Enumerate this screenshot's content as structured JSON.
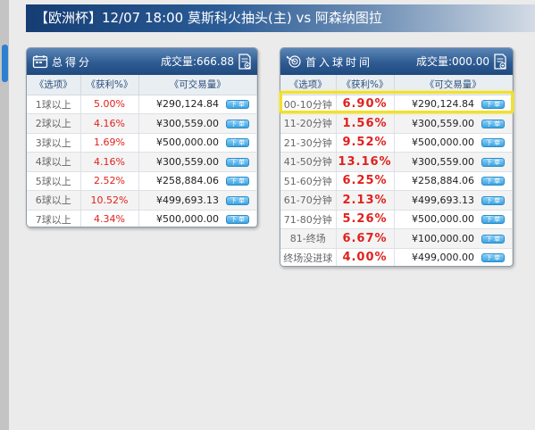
{
  "title": "【欧洲杯】12/07 18:00 莫斯科火抽头(主) vs 阿森纳图拉",
  "colors": {
    "accent": "#1f4a80",
    "rate_red": "#e0211d",
    "highlight": "#f2e12a"
  },
  "bet_label": "下 单",
  "panel_total": {
    "title": "总得分",
    "volume": "成交量:666.88",
    "headers": [
      "《选项》",
      "《获利%》",
      "《可交易量》"
    ],
    "rows": [
      {
        "option": "1球以上",
        "rate": "5.00%",
        "amount": "¥290,124.84"
      },
      {
        "option": "2球以上",
        "rate": "4.16%",
        "amount": "¥300,559.00"
      },
      {
        "option": "3球以上",
        "rate": "1.69%",
        "amount": "¥500,000.00"
      },
      {
        "option": "4球以上",
        "rate": "4.16%",
        "amount": "¥300,559.00"
      },
      {
        "option": "5球以上",
        "rate": "2.52%",
        "amount": "¥258,884.06"
      },
      {
        "option": "6球以上",
        "rate": "10.52%",
        "amount": "¥499,693.13"
      },
      {
        "option": "7球以上",
        "rate": "4.34%",
        "amount": "¥500,000.00"
      }
    ]
  },
  "panel_first_goal": {
    "title": "首入球时间",
    "volume": "成交量:000.00",
    "headers": [
      "《选项》",
      "《获利%》",
      "《可交易量》"
    ],
    "rows": [
      {
        "option": "00-10分钟",
        "rate": "6.90%",
        "amount": "¥290,124.84"
      },
      {
        "option": "11-20分钟",
        "rate": "1.56%",
        "amount": "¥300,559.00"
      },
      {
        "option": "21-30分钟",
        "rate": "9.52%",
        "amount": "¥500,000.00"
      },
      {
        "option": "41-50分钟",
        "rate": "13.16%",
        "amount": "¥300,559.00"
      },
      {
        "option": "51-60分钟",
        "rate": "6.25%",
        "amount": "¥258,884.06"
      },
      {
        "option": "61-70分钟",
        "rate": "2.13%",
        "amount": "¥499,693.13"
      },
      {
        "option": "71-80分钟",
        "rate": "5.26%",
        "amount": "¥500,000.00"
      },
      {
        "option": "81-终场",
        "rate": "6.67%",
        "amount": "¥100,000.00"
      },
      {
        "option": "终场没进球",
        "rate": "4.00%",
        "amount": "¥499,000.00"
      }
    ]
  }
}
